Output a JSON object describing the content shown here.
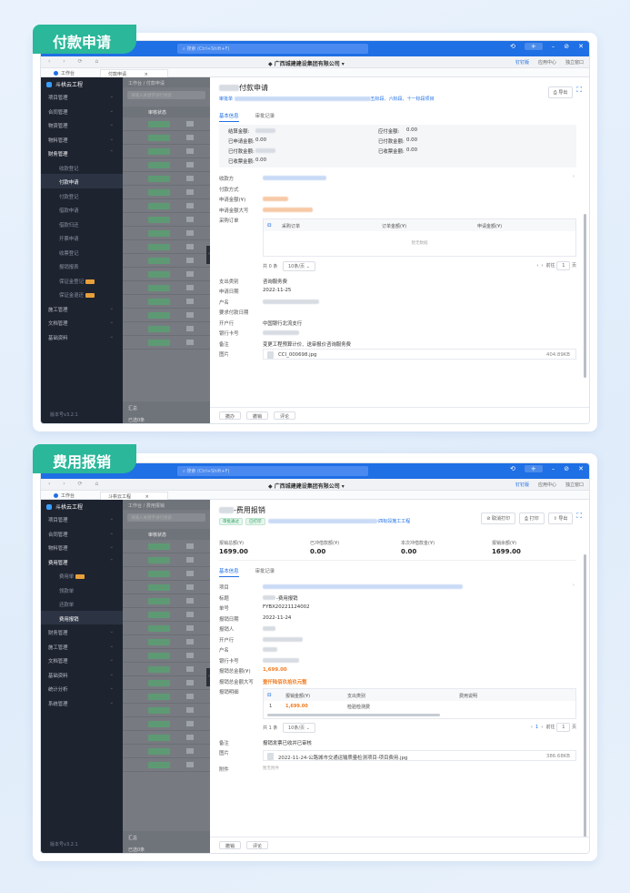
{
  "ribbons": {
    "first": "付款申请",
    "second": "费用报销"
  },
  "window": {
    "search_placeholder": "搜索 (Ctrl+Shift+F)",
    "company": "广西城建建设集团有限公司",
    "nav_right": [
      "钉钉版",
      "应用中心",
      "独立窗口"
    ],
    "tab_home": "工作台"
  },
  "screen1": {
    "tab": "付款申请",
    "sidebar": {
      "logo": "斗栱云工程",
      "items": [
        "项目管理",
        "合同管理",
        "物资管理",
        "物料管理",
        "财务管理"
      ],
      "subitems": [
        "收款登记",
        "付款申请",
        "付款登记",
        "借款申请",
        "借款归还",
        "开票申请",
        "收票登记",
        "报销报表",
        "保证金登记",
        "保证金退还"
      ],
      "items_after": [
        "施工管理",
        "文档管理",
        "基础资料"
      ],
      "footer": "版本号v3.2.1"
    },
    "list": {
      "breadcrumb": "工作台 / 付款申请",
      "search_placeholder": "请输入关键字进行搜索",
      "head": "审核状态",
      "foot1": "汇总",
      "foot2": "已选0条"
    },
    "drawer": {
      "title": "付款申请",
      "sub_prefix": "审批单",
      "sub_tail": "五标段、六标段、十一标段项目",
      "export": "导出",
      "tabs": [
        "基本信息",
        "审批记录"
      ],
      "grey_rows": [
        {
          "l1": "结算金额:",
          "v1": "",
          "l2": "应付金额:",
          "v2": "0.00"
        },
        {
          "l1": "已申请金额:",
          "v1": "0.00",
          "l2": "已付款金额:",
          "v2": "0.00"
        },
        {
          "l1": "已付款金额:",
          "v1": "",
          "l2": "已收票金额:",
          "v2": "0.00"
        },
        {
          "l1": "已收票金额:",
          "v1": "0.00",
          "l2": "",
          "v2": ""
        }
      ],
      "labels": [
        "收款方",
        "付款方式",
        "申请金额(¥)",
        "申请金额大写",
        "采购订单"
      ],
      "table_heads": [
        "采购订单",
        "订单金额(¥)",
        "申请金额(¥)"
      ],
      "empty": "暂无数据",
      "pager": {
        "total": "共 0 条",
        "size": "10条/页",
        "goto": "前往",
        "page": "1",
        "unit": "页"
      },
      "rows": [
        {
          "label": "支出类别",
          "value": "咨询服务费"
        },
        {
          "label": "申请日期",
          "value": "2022-11-25"
        },
        {
          "label": "户名",
          "value": ""
        },
        {
          "label": "要求付款日期",
          "value": ""
        },
        {
          "label": "开户行",
          "value": "中国银行北流支行"
        },
        {
          "label": "银行卡号",
          "value": ""
        },
        {
          "label": "备注",
          "value": "变更工程预算计价、送审报价咨询服务费"
        },
        {
          "label": "图片",
          "value": ""
        }
      ],
      "file": {
        "name": "CCI_000698.jpg",
        "size": "404.89KB"
      },
      "footer": [
        "撤办",
        "撤销",
        "评论"
      ]
    }
  },
  "screen2": {
    "tab": "斗栱云工程",
    "sidebar": {
      "logo": "斗栱云工程",
      "items": [
        "项目管理",
        "合同管理",
        "物料管理",
        "费用管理"
      ],
      "subitems": [
        "费用单",
        "领款单",
        "还款单",
        "费用报销"
      ],
      "items_after": [
        "财务管理",
        "施工管理",
        "文档管理",
        "基础资料",
        "统计分析",
        "系统管理"
      ],
      "footer": "版本号v3.2.1"
    },
    "list": {
      "breadcrumb": "工作台 / 费用报销",
      "search_placeholder": "请输入关键字进行搜索",
      "head": "审核状态",
      "foot1": "汇总",
      "foot2": "已选0条"
    },
    "drawer": {
      "title": "-费用报销",
      "pills": [
        "审批通过",
        "已打印"
      ],
      "sub_tail": "-四标段施工工程",
      "btns": [
        "取消打印",
        "打印",
        "导出"
      ],
      "summary": [
        {
          "label": "报销总额(¥)",
          "value": "1699.00"
        },
        {
          "label": "已冲借款额(¥)",
          "value": "0.00"
        },
        {
          "label": "本次冲借款金(¥)",
          "value": "0.00"
        },
        {
          "label": "报销余额(¥)",
          "value": "1699.00"
        }
      ],
      "tabs": [
        "基本信息",
        "审批记录"
      ],
      "rows": [
        {
          "label": "项目",
          "value": ""
        },
        {
          "label": "标题",
          "value": "-费用报销"
        },
        {
          "label": "单号",
          "value": "FYBX20221124002"
        },
        {
          "label": "报销日期",
          "value": "2022-11-24"
        },
        {
          "label": "报销人",
          "value": ""
        },
        {
          "label": "开户行",
          "value": ""
        },
        {
          "label": "户名",
          "value": ""
        },
        {
          "label": "银行卡号",
          "value": ""
        },
        {
          "label": "报销总金额(¥)",
          "value": "1,699.00"
        },
        {
          "label": "报销总金额大写",
          "value": "壹仟陆佰玖拾玖元整"
        },
        {
          "label": "报销明细",
          "value": ""
        }
      ],
      "table_heads": [
        "报销金额(¥)",
        "支出类别",
        "费用说明"
      ],
      "table_row": {
        "idx": "1",
        "amount": "1,699.00",
        "category": "检验检测费"
      },
      "pager": {
        "total": "共 1 条",
        "size": "10条/页",
        "page": "1",
        "goto": "前往",
        "gopage": "1",
        "unit": "页"
      },
      "rows2": [
        {
          "label": "备注",
          "value": "报销发票已收并已审核"
        },
        {
          "label": "图片",
          "value": ""
        }
      ],
      "file": {
        "name": "2022-11-24-公路城市交通运输质量检测项目-项目费用.jpg",
        "size": "386.68KB"
      },
      "attach": {
        "label": "附件",
        "value": "暂无附件"
      },
      "footer": [
        "撤销",
        "评论"
      ]
    }
  }
}
